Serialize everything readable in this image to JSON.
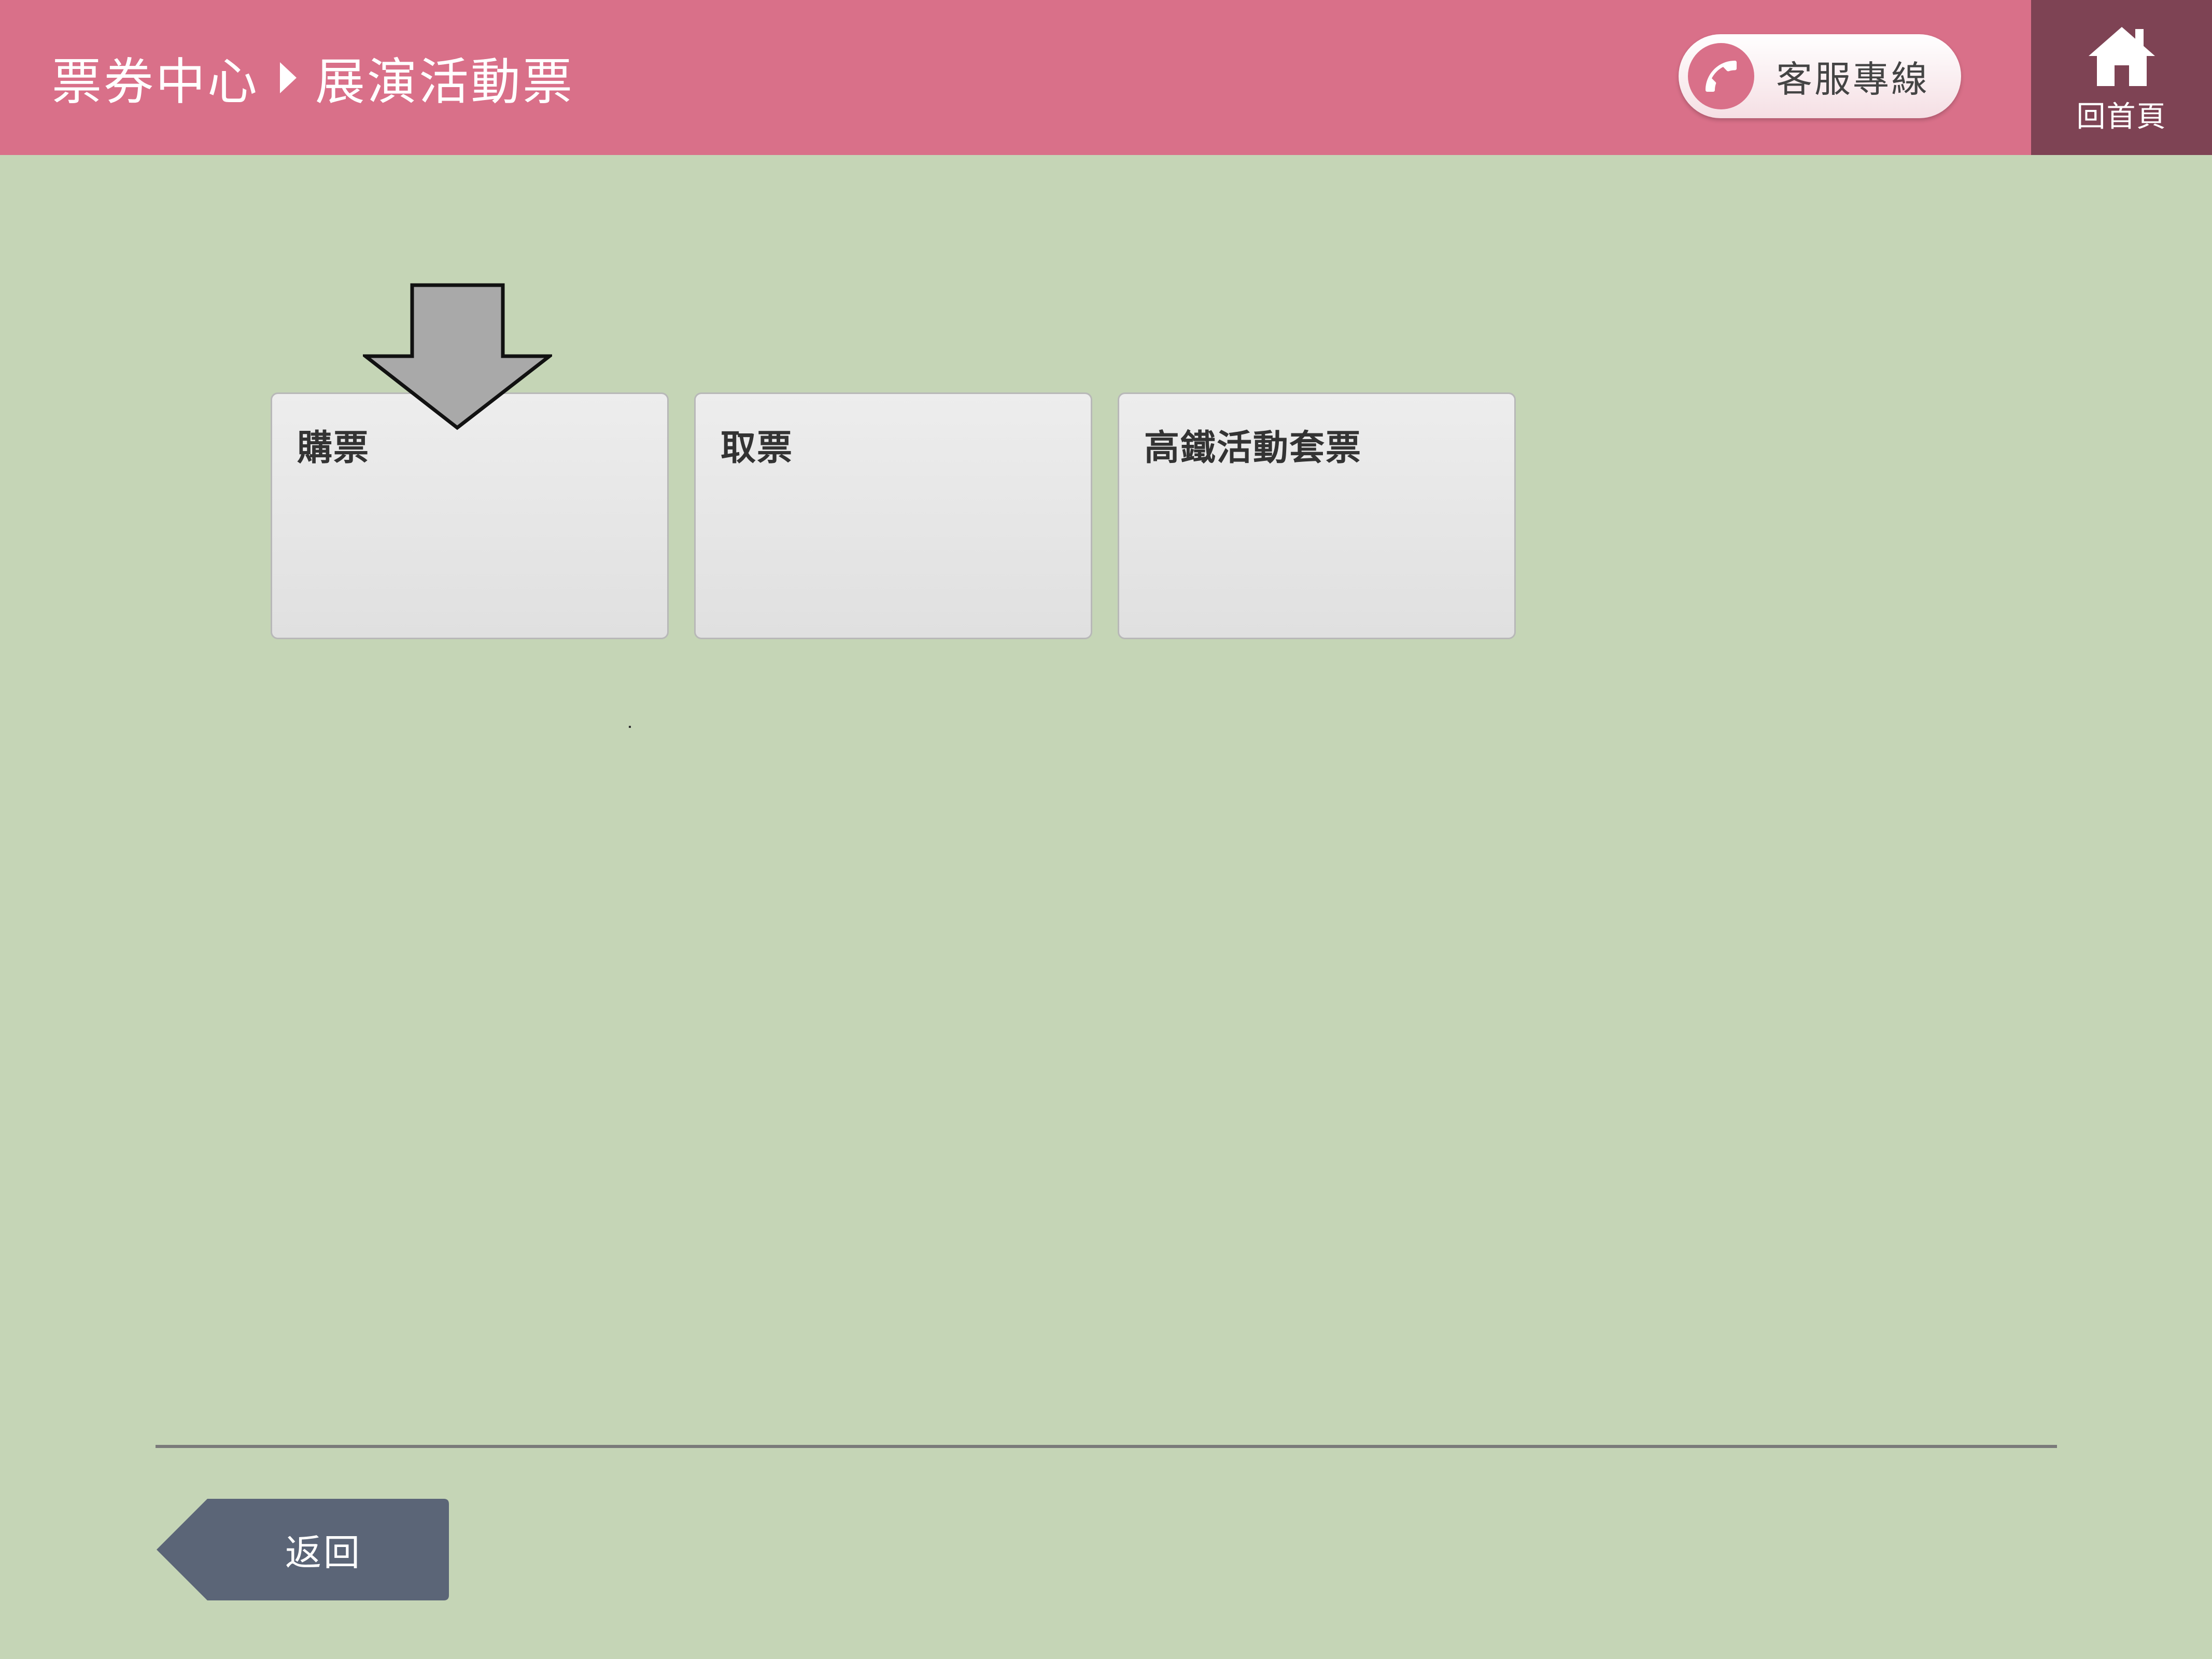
{
  "header": {
    "breadcrumb": {
      "parent": "票券中心",
      "current": "展演活動票"
    },
    "service_label": "客服專線",
    "home_label": "回首頁"
  },
  "tiles": [
    {
      "label": "購票"
    },
    {
      "label": "取票"
    },
    {
      "label": "高鐵活動套票"
    }
  ],
  "footer": {
    "back_label": "返回"
  },
  "colors": {
    "header_bg": "#d97089",
    "home_bg": "#7e4354",
    "page_bg": "#c5d5b6",
    "back_button": "#5b6577",
    "arrow_fill": "#a9a9a9"
  },
  "icons": {
    "phone": "phone-icon",
    "home": "home-icon",
    "arrow": "down-arrow-icon"
  }
}
